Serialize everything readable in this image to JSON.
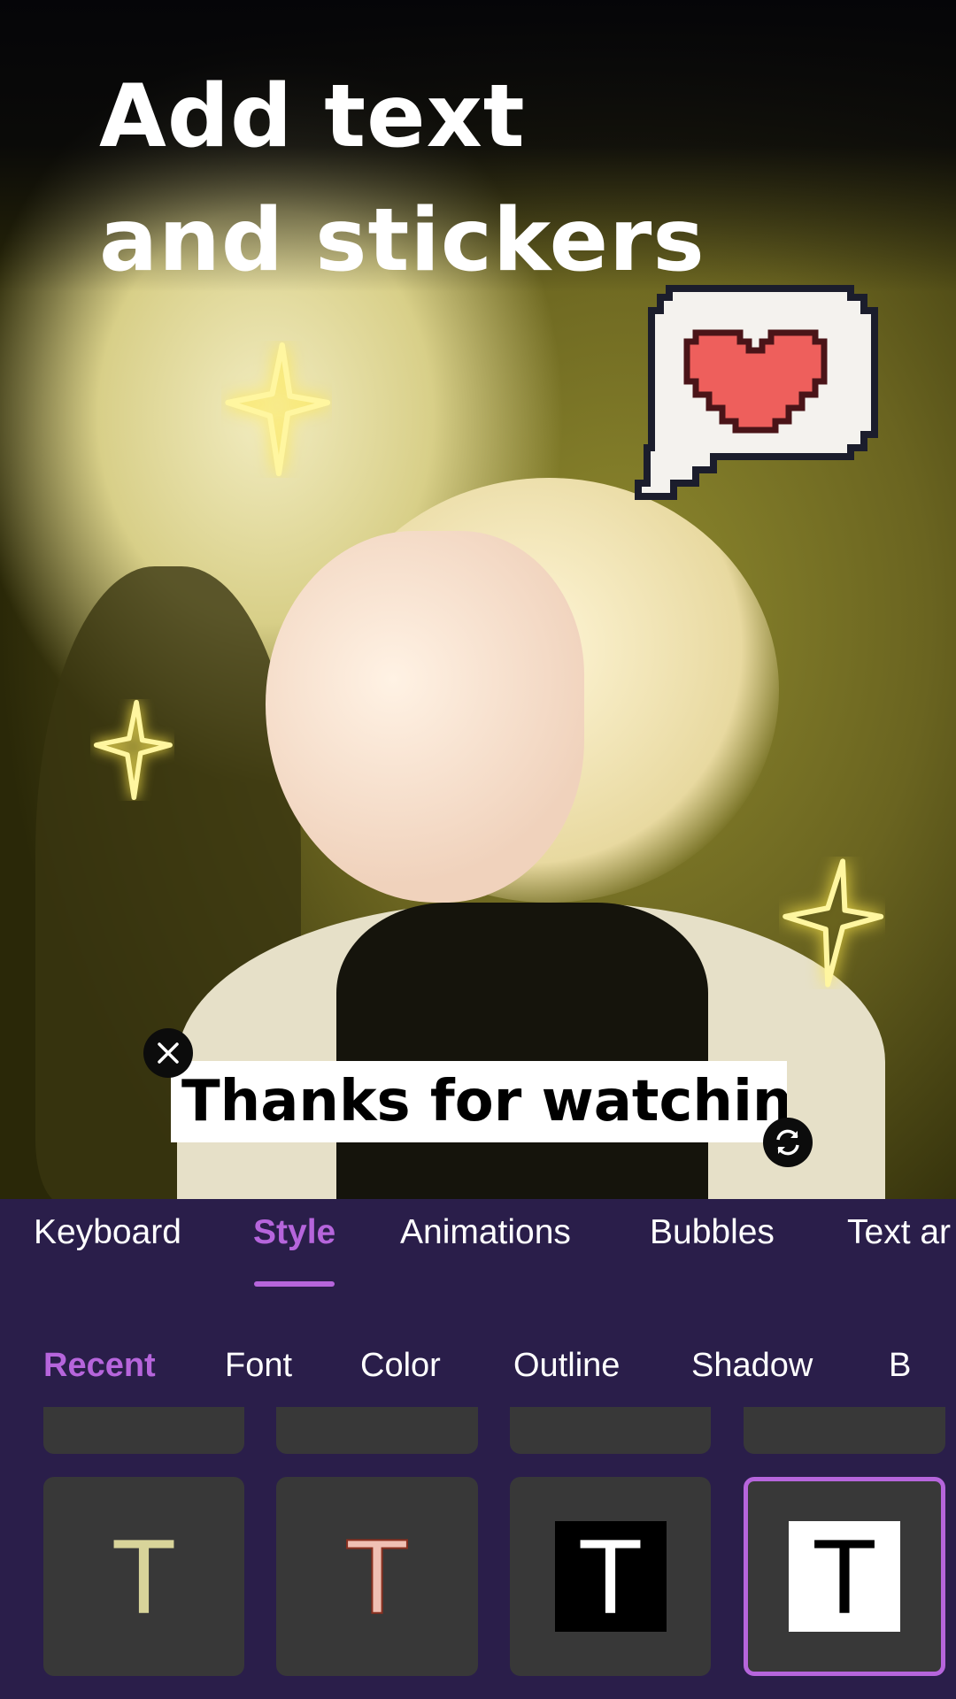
{
  "headline": {
    "line1": "Add text",
    "line2": "and stickers"
  },
  "caption": {
    "text": "Thanks for watching!",
    "close_icon": "close-icon",
    "rotate_icon": "rotate-icon"
  },
  "stickers": [
    "sparkle",
    "pixel-heart-speech-bubble",
    "sparkle",
    "sparkle"
  ],
  "tabs": [
    {
      "label": "Keyboard"
    },
    {
      "label": "Style",
      "active": true
    },
    {
      "label": "Animations"
    },
    {
      "label": "Bubbles"
    },
    {
      "label": "Text ar"
    }
  ],
  "subtabs": [
    {
      "label": "Recent",
      "active": true
    },
    {
      "label": "Font"
    },
    {
      "label": "Color"
    },
    {
      "label": "Outline"
    },
    {
      "label": "Shadow"
    },
    {
      "label": "B"
    }
  ],
  "style_presets": [
    {
      "glyph": "T",
      "color": "#d8d49a",
      "bg": "none"
    },
    {
      "glyph": "T",
      "color": "#f0c0b4",
      "bg": "none"
    },
    {
      "glyph": "T",
      "color": "#ffffff",
      "bg": "#000000"
    },
    {
      "glyph": "T",
      "color": "#000000",
      "bg": "#ffffff",
      "selected": true
    }
  ],
  "colors": {
    "accent": "#b665dc",
    "panel": "#2a1e4a",
    "tile": "#383838"
  }
}
